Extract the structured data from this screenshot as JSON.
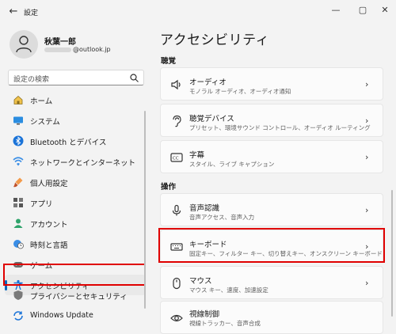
{
  "app": {
    "title": "設定",
    "back_icon": "back-arrow-icon"
  },
  "window_controls": [
    "minimize-icon",
    "maximize-icon",
    "close-icon"
  ],
  "profile": {
    "name": "秋葉一郎",
    "email_visible": "@outlook.jp"
  },
  "search": {
    "placeholder": "設定の検索"
  },
  "sidebar": {
    "items": [
      {
        "label": "ホーム",
        "icon": "home-icon"
      },
      {
        "label": "システム",
        "icon": "monitor-icon"
      },
      {
        "label": "Bluetooth とデバイス",
        "icon": "bluetooth-icon"
      },
      {
        "label": "ネットワークとインターネット",
        "icon": "wifi-icon"
      },
      {
        "label": "個人用設定",
        "icon": "brush-icon"
      },
      {
        "label": "アプリ",
        "icon": "apps-icon"
      },
      {
        "label": "アカウント",
        "icon": "person-icon"
      },
      {
        "label": "時刻と言語",
        "icon": "globe-clock-icon"
      },
      {
        "label": "ゲーム",
        "icon": "gamepad-icon"
      },
      {
        "label": "アクセシビリティ",
        "icon": "accessibility-icon",
        "active": true
      },
      {
        "label": "プライバシーとセキュリティ",
        "icon": "shield-icon"
      },
      {
        "label": "Windows Update",
        "icon": "update-icon"
      }
    ]
  },
  "main": {
    "title": "アクセシビリティ",
    "sections": [
      {
        "heading": "聴覚",
        "cards": [
          {
            "title": "オーディオ",
            "subtitle": "モノラル オーディオ、オーディオ通知",
            "icon": "speaker-icon"
          },
          {
            "title": "聴覚デバイス",
            "subtitle": "プリセット、環境サウンド コントロール、オーディオ ルーティング",
            "icon": "ear-icon"
          },
          {
            "title": "字幕",
            "subtitle": "スタイル、ライブ キャプション",
            "icon": "captions-icon"
          }
        ]
      },
      {
        "heading": "操作",
        "cards": [
          {
            "title": "音声認識",
            "subtitle": "音声アクセス、音声入力",
            "icon": "microphone-icon"
          },
          {
            "title": "キーボード",
            "subtitle": "固定キー、フィルター キー、切り替えキー、オンスクリーン キーボード",
            "icon": "keyboard-icon"
          },
          {
            "title": "マウス",
            "subtitle": "マウス キー、速度、加速設定",
            "icon": "mouse-icon"
          },
          {
            "title": "視線制御",
            "subtitle": "視線トラッカー、音声合成",
            "icon": "eye-icon"
          }
        ]
      }
    ]
  },
  "colors": {
    "accent": "#0067c0",
    "highlight": "#e00000"
  }
}
